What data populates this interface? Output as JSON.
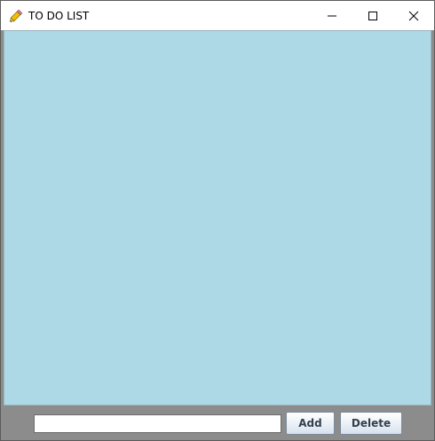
{
  "window": {
    "title": "TO DO LIST",
    "app_icon": "pencil-icon",
    "controls": {
      "minimize": "minimize-icon",
      "maximize": "maximize-icon",
      "close": "close-icon"
    }
  },
  "content": {
    "background_color": "#add8e6",
    "items": []
  },
  "footer": {
    "background_color": "#8c8c8c",
    "task_input": {
      "value": "",
      "placeholder": ""
    },
    "add_label": "Add",
    "delete_label": "Delete"
  }
}
